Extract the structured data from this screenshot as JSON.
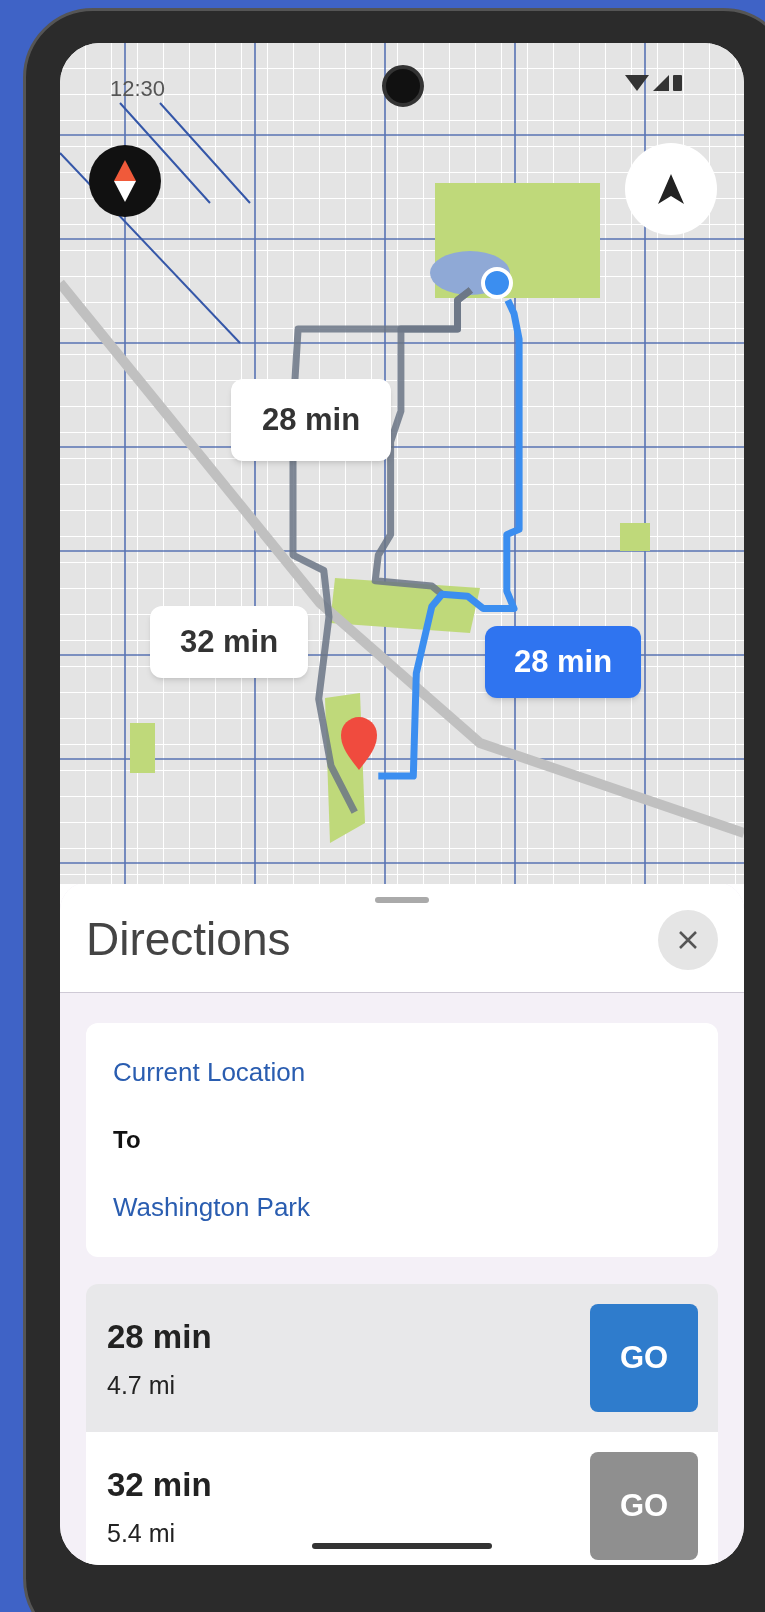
{
  "status_bar": {
    "time": "12:30"
  },
  "map": {
    "route_labels": [
      {
        "text": "28 min",
        "selected": false
      },
      {
        "text": "32 min",
        "selected": false
      },
      {
        "text": "28 min",
        "selected": true
      }
    ]
  },
  "sheet": {
    "title": "Directions",
    "from": "Current Location",
    "to_label": "To",
    "to": "Washington Park"
  },
  "routes": [
    {
      "duration": "28 min",
      "distance": "4.7 mi",
      "button": "GO",
      "selected": true
    },
    {
      "duration": "32 min",
      "distance": "5.4 mi",
      "button": "GO",
      "selected": false
    }
  ]
}
